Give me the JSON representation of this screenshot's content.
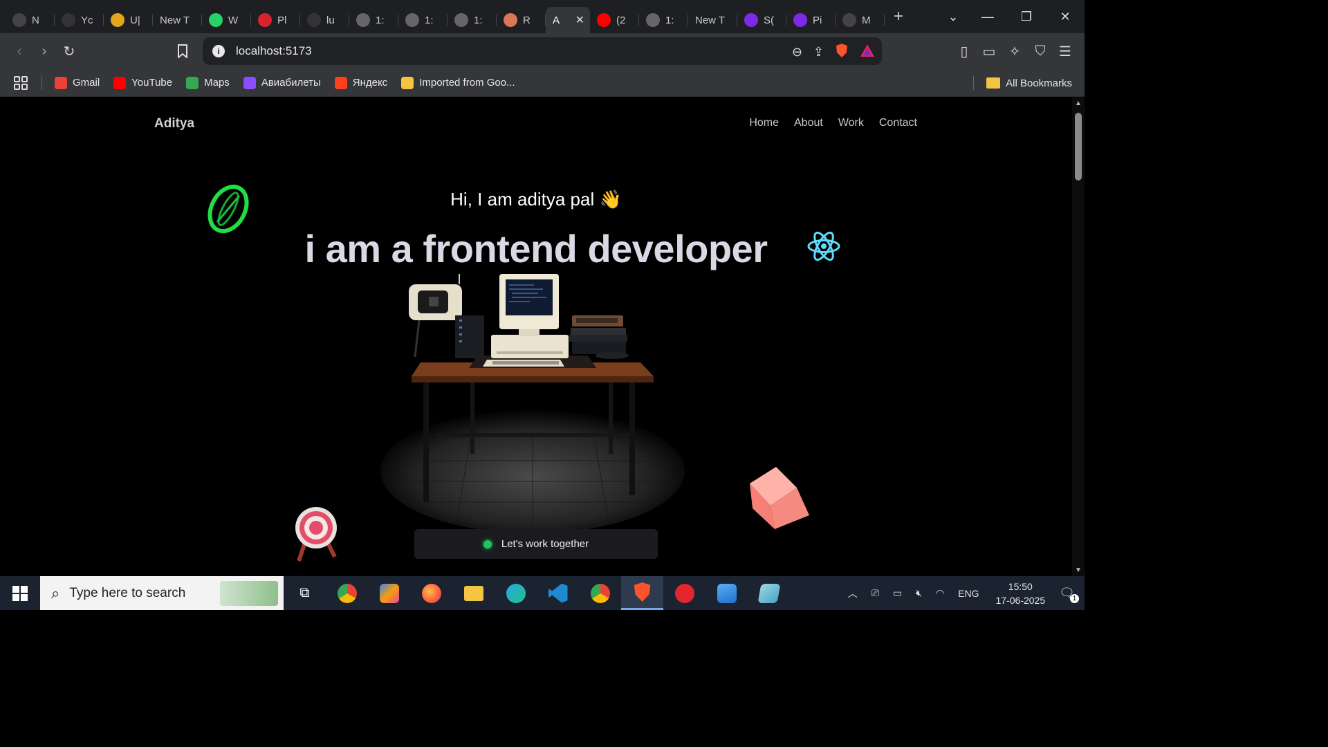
{
  "browser": {
    "tabs": [
      {
        "label": "N",
        "icon": "openai-icon",
        "color": "#444"
      },
      {
        "label": "Yc",
        "icon": "github-icon",
        "color": "#333"
      },
      {
        "label": "U|",
        "icon": "udemy-icon",
        "color": "#e3a51b"
      },
      {
        "label": "New T",
        "icon": "",
        "color": ""
      },
      {
        "label": "W",
        "icon": "whatsapp-icon",
        "color": "#25d366"
      },
      {
        "label": "Pl",
        "icon": "pngsvg-icon",
        "color": "#d9232e"
      },
      {
        "label": "lu",
        "icon": "github-icon",
        "color": "#333"
      },
      {
        "label": "1:",
        "icon": "globe-icon",
        "color": "#666"
      },
      {
        "label": "1:",
        "icon": "globe-icon",
        "color": "#666"
      },
      {
        "label": "1:",
        "icon": "bars-icon",
        "color": "#666"
      },
      {
        "label": "R",
        "icon": "claude-icon",
        "color": "#d97757"
      },
      {
        "label": "A",
        "icon": "",
        "color": "",
        "active": true
      },
      {
        "label": "(2",
        "icon": "youtube-icon",
        "color": "#ff0000"
      },
      {
        "label": "1:",
        "icon": "globe-icon",
        "color": "#666"
      },
      {
        "label": "New T",
        "icon": "",
        "color": ""
      },
      {
        "label": "S(",
        "icon": "canva-icon",
        "color": "#7d2ae8"
      },
      {
        "label": "Pi",
        "icon": "canva-icon",
        "color": "#7d2ae8"
      },
      {
        "label": "M",
        "icon": "openai-icon",
        "color": "#444"
      }
    ],
    "url": "localhost:5173",
    "bookmarks": [
      {
        "label": "Gmail",
        "icon": "gmail-icon",
        "color": "#ea4335"
      },
      {
        "label": "YouTube",
        "icon": "youtube-icon",
        "color": "#ff0000"
      },
      {
        "label": "Maps",
        "icon": "maps-icon",
        "color": "#34a853"
      },
      {
        "label": "Авиабилеты",
        "icon": "aviasales-icon",
        "color": "#8a4fff"
      },
      {
        "label": "Яндекс",
        "icon": "yandex-icon",
        "color": "#fc3f1d"
      },
      {
        "label": "Imported from Goo...",
        "icon": "folder-icon",
        "color": "#f4c542"
      }
    ],
    "all_bookmarks": "All Bookmarks"
  },
  "page": {
    "brand": "Aditya",
    "nav": [
      "Home",
      "About",
      "Work",
      "Contact"
    ],
    "hello": "Hi, I am aditya pal 👋",
    "headline": "i am a frontend developer",
    "cta": "Let's work together"
  },
  "taskbar": {
    "search_placeholder": "Type here to search",
    "language": "ENG",
    "time": "15:50",
    "date": "17-06-2025",
    "notifications": "1"
  }
}
